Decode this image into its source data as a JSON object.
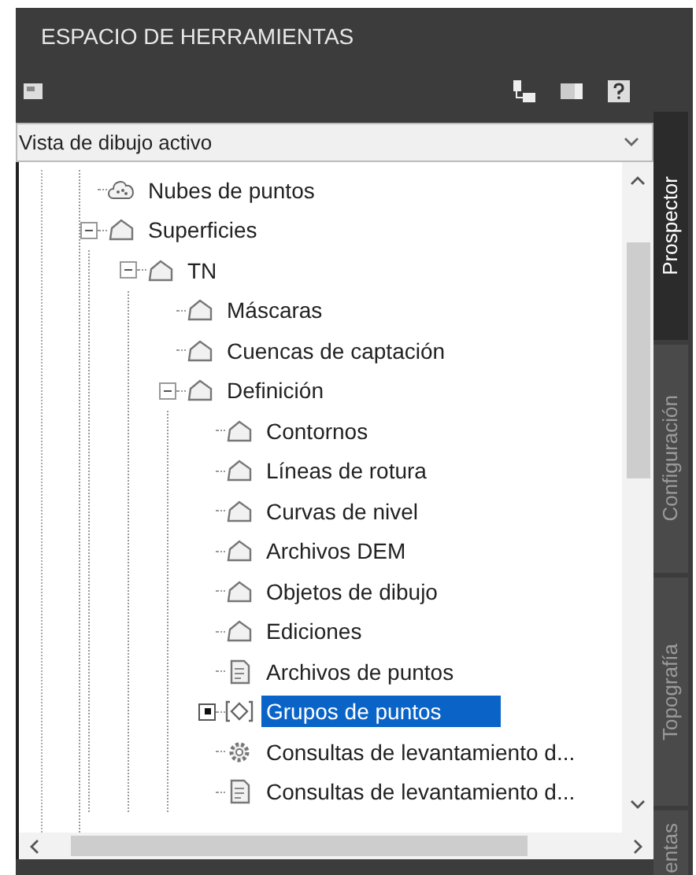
{
  "window": {
    "title": "ESPACIO DE HERRAMIENTAS"
  },
  "dropdown": {
    "value": "Vista de dibujo activo"
  },
  "tree": [
    {
      "label": "Nubes de puntos",
      "kind": "cloud",
      "selected": false
    },
    {
      "label": "Superficies",
      "kind": "surface",
      "selected": false,
      "expanded": true,
      "children": [
        {
          "label": "TN",
          "kind": "surface",
          "selected": false,
          "expanded": true,
          "children": [
            {
              "label": "Máscaras",
              "kind": "surface",
              "selected": false
            },
            {
              "label": "Cuencas de captación",
              "kind": "surface",
              "selected": false
            },
            {
              "label": "Definición",
              "kind": "surface",
              "selected": false,
              "expanded": true,
              "children": [
                {
                  "label": "Contornos",
                  "kind": "surface",
                  "selected": false
                },
                {
                  "label": "Líneas de rotura",
                  "kind": "surface",
                  "selected": false
                },
                {
                  "label": "Curvas de nivel",
                  "kind": "surface",
                  "selected": false
                },
                {
                  "label": "Archivos DEM",
                  "kind": "surface",
                  "selected": false
                },
                {
                  "label": "Objetos de dibujo",
                  "kind": "surface",
                  "selected": false
                },
                {
                  "label": "Ediciones",
                  "kind": "surface",
                  "selected": false
                },
                {
                  "label": "Archivos de puntos",
                  "kind": "file",
                  "selected": false
                },
                {
                  "label": "Grupos de puntos",
                  "kind": "group",
                  "selected": true,
                  "expanded": false
                },
                {
                  "label": "Consultas de levantamiento d...",
                  "kind": "gear",
                  "selected": false
                },
                {
                  "label": "Consultas de levantamiento d...",
                  "kind": "file",
                  "selected": false
                }
              ]
            }
          ]
        }
      ]
    }
  ],
  "side_tabs": [
    {
      "label": "Prospector",
      "selected": true
    },
    {
      "label": "Configuración",
      "selected": false
    },
    {
      "label": "Topografía",
      "selected": false
    },
    {
      "label": "entas",
      "selected": false
    }
  ]
}
